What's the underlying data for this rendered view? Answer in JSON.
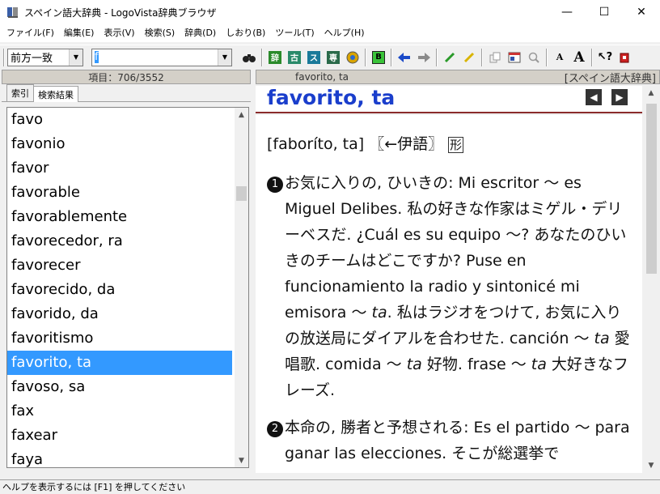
{
  "window": {
    "title": "スペイン語大辞典 - LogoVista辞典ブラウザ",
    "minimize": "—",
    "maximize": "☐",
    "close": "✕"
  },
  "menu": [
    "ファイル(F)",
    "編集(E)",
    "表示(V)",
    "検索(S)",
    "辞典(D)",
    "しおり(B)",
    "ツール(T)",
    "ヘルプ(H)"
  ],
  "toolbar": {
    "search_mode": "前方一致",
    "search_text": "f"
  },
  "left": {
    "count_label": "項目：706/3552",
    "tabs": [
      "索引",
      "検索結果"
    ],
    "items": [
      "favo",
      "favonio",
      "favor",
      "favorable",
      "favorablemente",
      "favorecedor, ra",
      "favorecer",
      "favorecido, da",
      "favorido, da",
      "favoritismo",
      "favorito, ta",
      "favoso, sa",
      "fax",
      "faxear",
      "faya"
    ],
    "selected": "favorito, ta"
  },
  "right": {
    "header_word": "favorito, ta",
    "dict_name": "[スペイン語大辞典]",
    "headword": "favorito, ta",
    "pronunciation": "[faboríto, ta] 〖←伊語〗",
    "pos": "形",
    "sense1": {
      "num": "1",
      "t1": "お気に入りの, ひいきの: Mi escritor ～ es Miguel Delibes. 私の好きな作家はミゲル・デリーベスだ. ¿Cuál es su equipo ～? あなたのひいきのチームはどこですか? Puse en funcionamiento la radio y sintonicé mi emisora ～ ",
      "e1": "ta",
      "t2": ". 私はラジオをつけて, お気に入りの放送局にダイアルを合わせた. canción ～ ",
      "e2": "ta",
      "t3": " 愛唱歌. comida ～ ",
      "e3": "ta",
      "t4": " 好物. frase ～ ",
      "e4": "ta",
      "t5": " 大好きなフレーズ."
    },
    "sense2": {
      "num": "2",
      "text": "本命の, 勝者と予想される: Es el partido ～ para ganar las elecciones. そこが総選挙で"
    }
  },
  "status": "ヘルプを表示するには [F1] を押してください"
}
